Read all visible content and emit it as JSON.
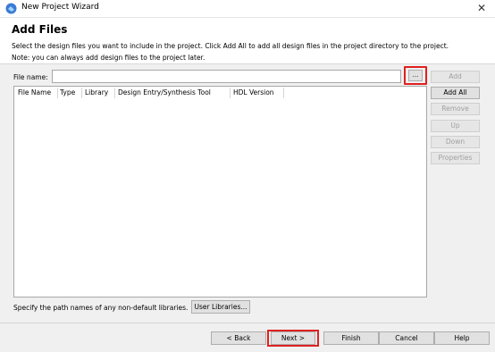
{
  "window": {
    "title": "New Project Wizard",
    "close_glyph": "✕"
  },
  "header": {
    "heading": "Add Files",
    "description_line1": "Select the design files you want to include in the project. Click Add All to add all design files in the project directory to the project.",
    "description_line2": "Note: you can always add design files to the project later."
  },
  "file_name": {
    "label": "File name:",
    "value": "",
    "browse_label": "..."
  },
  "table": {
    "columns": [
      "File Name",
      "Type",
      "Library",
      "Design Entry/Synthesis Tool",
      "HDL Version"
    ]
  },
  "side_buttons": {
    "add": "Add",
    "add_all": "Add All",
    "remove": "Remove",
    "up": "Up",
    "down": "Down",
    "properties": "Properties"
  },
  "libraries": {
    "label": "Specify the path names of any non-default libraries.",
    "button": "User Libraries..."
  },
  "footer": {
    "back": "< Back",
    "next": "Next >",
    "finish": "Finish",
    "cancel": "Cancel",
    "help": "Help"
  },
  "colors": {
    "highlight": "#e02020",
    "dialog_bg": "#f0f0f0"
  }
}
